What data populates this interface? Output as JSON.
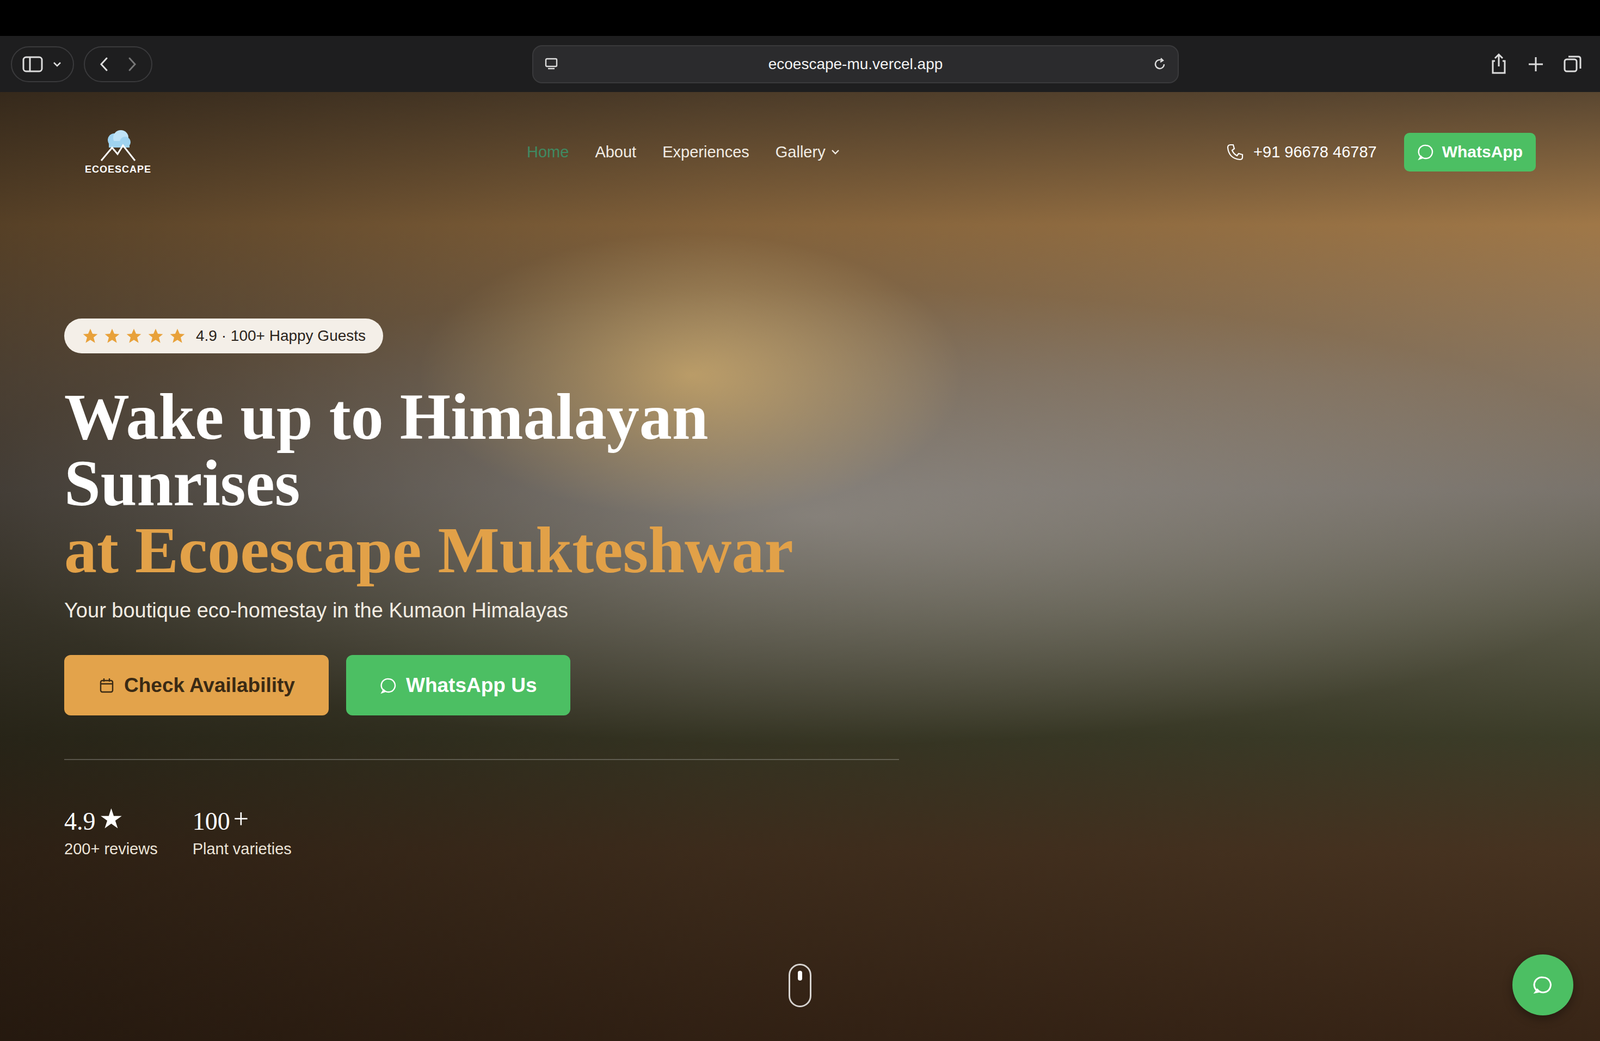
{
  "browser": {
    "url": "ecoescape-mu.vercel.app"
  },
  "nav": {
    "logo": "ECOESCAPE",
    "links": [
      {
        "label": "Home",
        "selected": true,
        "dropdown": false
      },
      {
        "label": "About",
        "selected": false,
        "dropdown": false
      },
      {
        "label": "Experiences",
        "selected": false,
        "dropdown": false
      },
      {
        "label": "Gallery",
        "selected": false,
        "dropdown": true
      }
    ],
    "phone": "+91 96678 46787",
    "cta": "WhatsApp"
  },
  "hero": {
    "rating": {
      "stars": 5,
      "text": "4.9 · 100+ Happy Guests"
    },
    "title": "Wake up to Himalayan Sunrises",
    "highlight": "at Ecoescape Mukteshwar",
    "subtitle": "Your boutique eco-homestay in the Kumaon Himalayas",
    "buttons": [
      {
        "label": "Check Availability",
        "kind": "booking"
      },
      {
        "label": "WhatsApp Us",
        "kind": "whatsapp"
      }
    ],
    "stats": [
      {
        "value": "4.9",
        "mark": "★",
        "label": "200+ reviews"
      },
      {
        "value": "100",
        "mark": "+",
        "label": "Plant varieties"
      }
    ]
  }
}
